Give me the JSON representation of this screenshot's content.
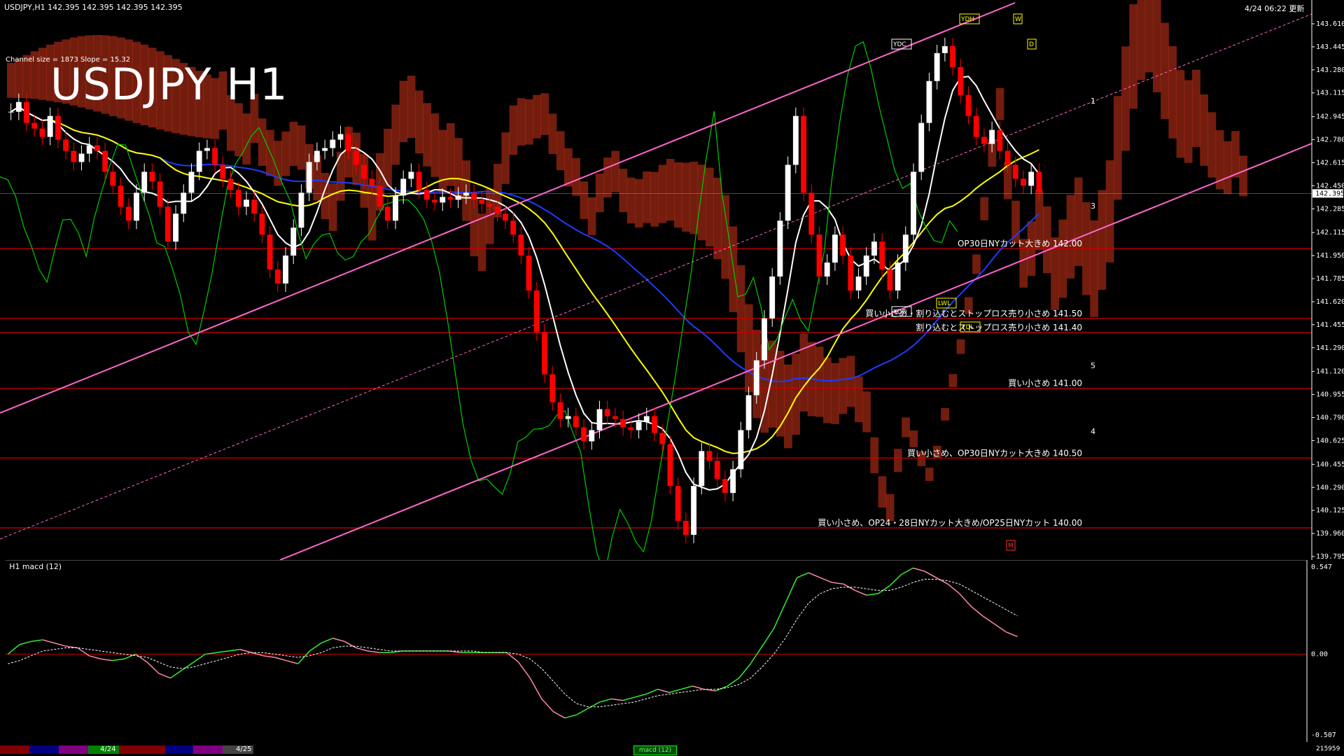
{
  "header": {
    "symbol_line": "USDJPY,H1  142.395 142.395 142.395 142.395",
    "channel_info": "Channel size = 1873 Slope = 15.32",
    "updated": "4/24 06:22 更新",
    "big_title": "USDJPY H1"
  },
  "colors": {
    "background": "#000000",
    "bull": "#ffffff",
    "bear": "#ff0000",
    "ma_fast": "#ffffff",
    "ma_mid": "#ffff00",
    "ma_slow": "#1e3cff",
    "channel": "#ff66cc",
    "chikou": "#00cc00",
    "level": "#cc0000",
    "kumo": "#ff4020",
    "macd": "#33ee33",
    "macd_neg": "#ff88aa",
    "signal": "#ffffff"
  },
  "chart_data": [
    {
      "type": "candlestick",
      "title": "USDJPY H1",
      "ylim": [
        139.795,
        143.61
      ],
      "y_ticks": [
        "143.610",
        "143.445",
        "143.280",
        "143.115",
        "142.945",
        "142.780",
        "142.615",
        "142.450",
        "142.285",
        "142.115",
        "141.950",
        "141.785",
        "141.620",
        "141.455",
        "141.290",
        "141.120",
        "140.955",
        "140.790",
        "140.625",
        "140.455",
        "140.290",
        "140.125",
        "139.960",
        "139.795"
      ],
      "current_price": "142.395",
      "close": [
        142.98,
        143.05,
        142.9,
        142.86,
        142.8,
        142.95,
        142.78,
        142.7,
        142.62,
        142.68,
        142.74,
        142.7,
        142.55,
        142.45,
        142.3,
        142.2,
        142.4,
        142.55,
        142.48,
        142.3,
        142.05,
        142.25,
        142.4,
        142.55,
        142.7,
        142.72,
        142.6,
        142.5,
        142.42,
        142.3,
        142.35,
        142.25,
        142.1,
        141.85,
        141.75,
        141.95,
        142.15,
        142.4,
        142.62,
        142.7,
        142.72,
        142.78,
        142.82,
        142.7,
        142.6,
        142.5,
        142.45,
        142.3,
        142.2,
        142.38,
        142.5,
        142.55,
        142.42,
        142.35,
        142.33,
        142.37,
        142.35,
        142.38,
        142.4,
        142.35,
        142.32,
        142.3,
        142.25,
        142.2,
        142.1,
        141.95,
        141.7,
        141.4,
        141.1,
        140.9,
        140.78,
        140.8,
        140.72,
        140.62,
        140.7,
        140.85,
        140.8,
        140.78,
        140.72,
        140.7,
        140.76,
        140.8,
        140.68,
        140.6,
        140.3,
        140.05,
        139.95,
        140.3,
        140.55,
        140.48,
        140.35,
        140.25,
        140.42,
        140.7,
        140.95,
        141.2,
        141.5,
        141.8,
        142.2,
        142.6,
        142.95,
        142.4,
        142.1,
        141.8,
        141.9,
        142.1,
        141.95,
        141.7,
        141.8,
        141.95,
        142.05,
        141.85,
        141.7,
        141.9,
        142.1,
        142.55,
        142.9,
        143.2,
        143.4,
        143.45,
        143.3,
        143.1,
        142.95,
        142.8,
        142.75,
        142.85,
        142.7,
        142.6,
        142.5,
        142.45,
        142.55,
        142.4
      ],
      "series": [
        {
          "name": "USDJPY H1"
        }
      ],
      "levels": [
        {
          "price": 142.0,
          "label": "OP30日NYカット大きめ 142.00"
        },
        {
          "price": 141.5,
          "label": "買い小さめ・割り込むとストップロス売り小さめ 141.50"
        },
        {
          "price": 141.4,
          "label": "割り込むとストップロス売り小さめ 141.40"
        },
        {
          "price": 141.0,
          "label": "買い小さめ 141.00"
        },
        {
          "price": 140.5,
          "label": "買い小さめ、OP30日NYカット大きめ 140.50"
        },
        {
          "price": 140.0,
          "label": "買い小さめ、OP24・28日NYカット大きめ/OP25日NYカット 140.00"
        }
      ],
      "markers": [
        "YDH",
        "YDC",
        "YDO",
        "YDL",
        "LWL",
        "W",
        "D",
        "M"
      ],
      "projection_labels": [
        "1",
        "3",
        "5",
        "4"
      ]
    },
    {
      "type": "line",
      "title": "H1 macd (12)",
      "ylim": [
        -0.507,
        0.547
      ],
      "y_ticks": [
        "0.547",
        "0.00",
        "-0.507"
      ],
      "series": [
        {
          "values": [
            0.0,
            0.06,
            0.08,
            0.09,
            0.07,
            0.05,
            0.04,
            -0.01,
            -0.03,
            -0.04,
            -0.03,
            0.0,
            -0.05,
            -0.12,
            -0.15,
            -0.1,
            -0.05,
            0.0,
            0.01,
            0.02,
            0.03,
            0.01,
            -0.01,
            -0.02,
            -0.04,
            -0.06,
            0.02,
            0.07,
            0.1,
            0.08,
            0.04,
            0.02,
            0.01,
            0.01,
            0.02,
            0.02,
            0.02,
            0.02,
            0.02,
            0.01,
            0.01,
            0.01,
            0.01,
            0.01,
            -0.05,
            -0.15,
            -0.28,
            -0.36,
            -0.4,
            -0.38,
            -0.34,
            -0.3,
            -0.28,
            -0.29,
            -0.27,
            -0.25,
            -0.22,
            -0.24,
            -0.22,
            -0.2,
            -0.22,
            -0.23,
            -0.2,
            -0.15,
            -0.06,
            0.05,
            0.16,
            0.32,
            0.48,
            0.51,
            0.48,
            0.45,
            0.44,
            0.4,
            0.37,
            0.38,
            0.43,
            0.5,
            0.54,
            0.52,
            0.48,
            0.44,
            0.38,
            0.3,
            0.24,
            0.19,
            0.14,
            0.11
          ]
        },
        {
          "values": [
            -0.06,
            -0.04,
            -0.01,
            0.02,
            0.03,
            0.04,
            0.04,
            0.03,
            0.02,
            0.01,
            0.0,
            -0.01,
            -0.02,
            -0.05,
            -0.08,
            -0.09,
            -0.08,
            -0.06,
            -0.04,
            -0.02,
            0.0,
            0.01,
            0.01,
            0.0,
            -0.01,
            -0.02,
            -0.01,
            0.01,
            0.04,
            0.05,
            0.05,
            0.04,
            0.03,
            0.02,
            0.02,
            0.02,
            0.02,
            0.02,
            0.02,
            0.02,
            0.02,
            0.01,
            0.01,
            0.01,
            0.0,
            -0.03,
            -0.09,
            -0.17,
            -0.25,
            -0.31,
            -0.33,
            -0.33,
            -0.32,
            -0.31,
            -0.3,
            -0.28,
            -0.26,
            -0.25,
            -0.24,
            -0.23,
            -0.22,
            -0.22,
            -0.21,
            -0.19,
            -0.15,
            -0.08,
            0.0,
            0.1,
            0.22,
            0.32,
            0.38,
            0.41,
            0.42,
            0.42,
            0.41,
            0.4,
            0.4,
            0.42,
            0.45,
            0.47,
            0.47,
            0.46,
            0.44,
            0.4,
            0.36,
            0.32,
            0.28,
            0.24
          ]
        }
      ]
    }
  ],
  "bottom_bar": {
    "dates": [
      "4/24",
      "4/25"
    ],
    "indicator_tab": "macd (12)",
    "right_value": "215959"
  }
}
